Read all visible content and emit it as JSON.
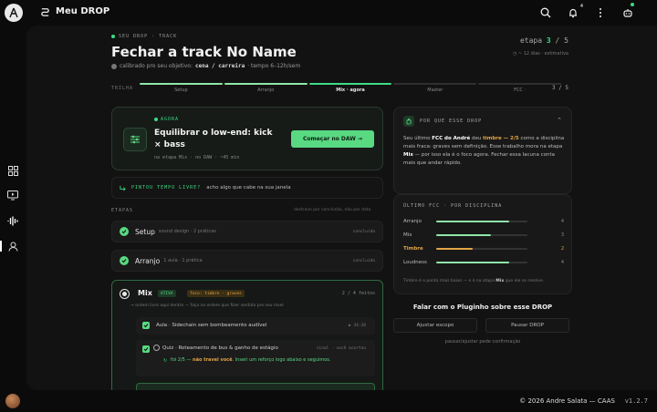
{
  "app": {
    "title": "Meu DROP"
  },
  "crumb": "SEU DROP · TRACK",
  "page": {
    "title": "Fechar a track No Name",
    "calibrated_prefix": "calibrado pro seu objetivo:",
    "calibrated_value": "cena / carreira",
    "calibrated_time": "· tempo 6–12h/sem",
    "step_label": "etapa",
    "step_current": "3",
    "step_total": "/ 5",
    "eta": "◷ ~ 12 dias · estimativa"
  },
  "trilha": {
    "label": "TRILHA",
    "count": "3 / 5",
    "segments": [
      {
        "label": "Setup",
        "state": "done"
      },
      {
        "label": "Arranjo",
        "state": "done"
      },
      {
        "label": "Mix · agora",
        "state": "current"
      },
      {
        "label": "Master",
        "state": "todo"
      },
      {
        "label": "FCC ·",
        "state": "todo"
      }
    ]
  },
  "now": {
    "tag": "AGORA",
    "title": "Equilibrar o low-end: kick × bass",
    "meta": "na etapa Mix · no DAW · ~45 min",
    "button": "Começar no DAW →"
  },
  "pintou": {
    "label": "PINTOU TEMPO LIVRE?",
    "text": "acho algo que cabe na sua janela"
  },
  "etapas": {
    "label": "ETAPAS",
    "right": "destravo por conclusão, não por data",
    "stages": [
      {
        "name": "Setup",
        "desc": "sound design · 2 práticas",
        "status": "concluída"
      },
      {
        "name": "Arranjo",
        "desc": "1 aula · 1 prática",
        "status": "concluída"
      }
    ],
    "mix": {
      "name": "Mix",
      "badge_active": "ATIVA",
      "badge_focus": "foco: timbre · graves",
      "count": "2 / 4 feitos",
      "hint": "→ ordem livre aqui dentro — faça na ordem que fizer sentido pro seu nível",
      "tasks": [
        {
          "text": "Aula · Sidechain sem bombeamento audível",
          "right": "▶ 34:28"
        },
        {
          "text": "Quiz · Roteamento de bus & ganho de estágio",
          "right": "sinal · você acertou"
        }
      ],
      "feedback_a": "foi 2/5 —",
      "feedback_b": "não travei você",
      "feedback_c": ". Inseri um reforço logo abaixo e seguimos."
    }
  },
  "why": {
    "heading": "POR QUE ESSE DROP",
    "p1": "Seu último",
    "p2": "FCC do André",
    "p3": "deu",
    "p4": "timbre — 2/5",
    "p5": "como a disciplina mais fraca: graves sem definição. Esse trabalho mora na etapa",
    "p6": "Mix",
    "p7": "— por isso ela é o foco agora. Fechar essa lacuna conta mais que andar rápido."
  },
  "fcc": {
    "heading": "ÚLTIMO FCC · POR DISCIPLINA",
    "rows": [
      {
        "label": "Arranjo",
        "value": "4",
        "pct": 0.8
      },
      {
        "label": "Mix",
        "value": "3",
        "pct": 0.6
      },
      {
        "label": "Timbre",
        "value": "2",
        "pct": 0.4,
        "highlight": true
      },
      {
        "label": "Loudness",
        "value": "4",
        "pct": 0.8
      }
    ],
    "foot_a": "Timbre é o ponto mais baixo — e é na etapa",
    "foot_b": "Mix",
    "foot_c": "que ele se resolve."
  },
  "pluginho": {
    "title": "Falar com o Pluginho sobre esse DROP",
    "adjust": "Ajustar escopo",
    "pause": "Pausar DROP",
    "note": "pausar/ajustar pede confirmação"
  },
  "footer": {
    "copyright": "© 2026 Andre Salata — CAAS",
    "version": "v1.2.7"
  },
  "colors": {
    "accent": "#3ddc84",
    "warn": "#e3a546",
    "bg": "#0b0b0b"
  }
}
